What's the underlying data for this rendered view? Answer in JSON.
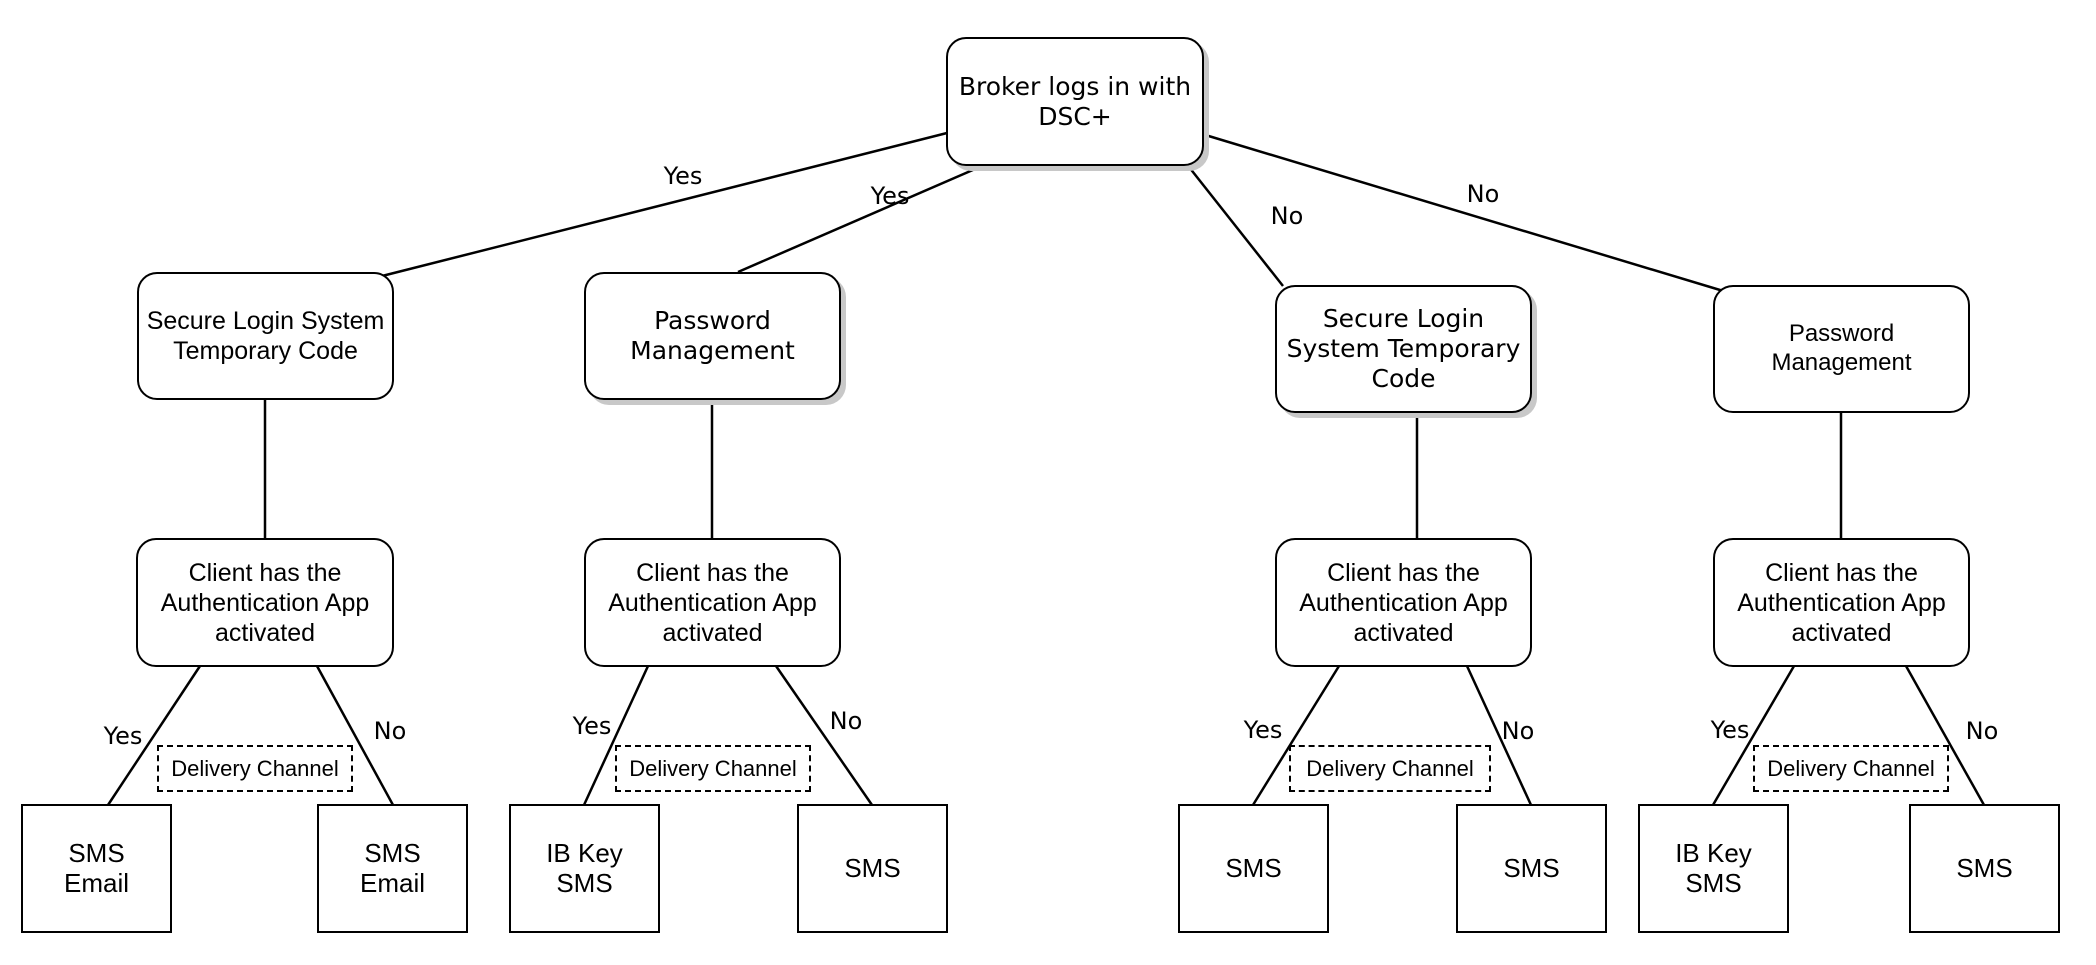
{
  "diagram": {
    "root": {
      "label": "Broker logs in with\nDSC+"
    },
    "branches": [
      {
        "edge_label": "Yes",
        "method": {
          "label": "Secure Login System\nTemporary Code"
        },
        "condition": {
          "label": "Client has the\nAuthentication App\nactivated"
        },
        "delivery_channel_label": "Delivery Channel",
        "yes": {
          "edge_label": "Yes",
          "label": "SMS\nEmail"
        },
        "no": {
          "edge_label": "No",
          "label": "SMS\nEmail"
        }
      },
      {
        "edge_label": "Yes",
        "method": {
          "label": "Password\nManagement"
        },
        "condition": {
          "label": "Client has the\nAuthentication App\nactivated"
        },
        "delivery_channel_label": "Delivery Channel",
        "yes": {
          "edge_label": "Yes",
          "label": "IB Key\nSMS"
        },
        "no": {
          "edge_label": "No",
          "label": "SMS"
        }
      },
      {
        "edge_label": "No",
        "method": {
          "label": "Secure Login\nSystem Temporary\nCode"
        },
        "condition": {
          "label": "Client has the\nAuthentication App\nactivated"
        },
        "delivery_channel_label": "Delivery Channel",
        "yes": {
          "edge_label": "Yes",
          "label": "SMS"
        },
        "no": {
          "edge_label": "No",
          "label": "SMS"
        }
      },
      {
        "edge_label": "No",
        "method": {
          "label": "Password\nManagement"
        },
        "condition": {
          "label": "Client has the\nAuthentication App\nactivated"
        },
        "delivery_channel_label": "Delivery Channel",
        "yes": {
          "edge_label": "Yes",
          "label": "IB Key\nSMS"
        },
        "no": {
          "edge_label": "No",
          "label": "SMS"
        }
      }
    ]
  }
}
